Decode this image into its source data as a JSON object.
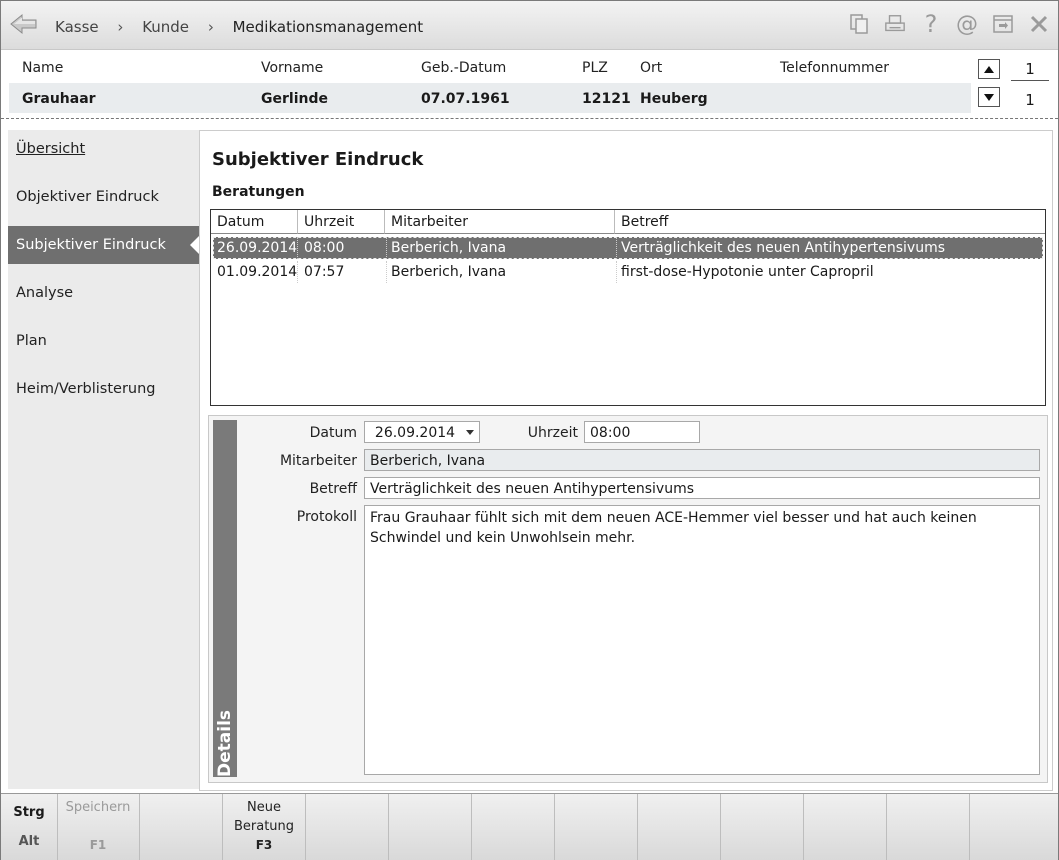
{
  "breadcrumb": [
    "Kasse",
    "Kunde",
    "Medikationsmanagement"
  ],
  "breadcrumb_sep": "›",
  "top_icons": [
    "document-icon",
    "print-icon",
    "help-icon",
    "at-icon",
    "window-icon",
    "close-icon"
  ],
  "customer": {
    "headers": {
      "name": "Name",
      "vorname": "Vorname",
      "geb": "Geb.-Datum",
      "plz": "PLZ",
      "ort": "Ort",
      "tel": "Telefonnummer"
    },
    "values": {
      "name": "Grauhaar",
      "vorname": "Gerlinde",
      "geb": "07.07.1961",
      "plz": "12121",
      "ort": "Heuberg",
      "tel": ""
    },
    "nav_top": "1",
    "nav_bottom": "1"
  },
  "nav": {
    "items": [
      {
        "label": "Übersicht",
        "active": false
      },
      {
        "label": "Objektiver Eindruck",
        "active": false
      },
      {
        "label": "Subjektiver Eindruck",
        "active": true
      },
      {
        "label": "Analyse",
        "active": false
      },
      {
        "label": "Plan",
        "active": false
      },
      {
        "label": "Heim/Verblisterung",
        "active": false
      }
    ]
  },
  "main": {
    "title": "Subjektiver Eindruck",
    "section": "Beratungen",
    "columns": [
      "Datum",
      "Uhrzeit",
      "Mitarbeiter",
      "Betreff"
    ],
    "rows": [
      {
        "datum": "26.09.2014",
        "uhrzeit": "08:00",
        "mitarbeiter": "Berberich, Ivana",
        "betreff": "Verträglichkeit des neuen Antihypertensivums"
      },
      {
        "datum": "01.09.2014",
        "uhrzeit": "07:57",
        "mitarbeiter": "Berberich, Ivana",
        "betreff": "first-dose-Hypotonie unter Capropril"
      }
    ]
  },
  "details": {
    "tab_label": "Details",
    "datum_label": "Datum",
    "datum_value": "26.09.2014",
    "uhrzeit_label": "Uhrzeit",
    "uhrzeit_value": "08:00",
    "mitarbeiter_label": "Mitarbeiter",
    "mitarbeiter_value": "Berberich, Ivana",
    "betreff_label": "Betreff",
    "betreff_value": "Verträglichkeit des neuen Antihypertensivums",
    "protokoll_label": "Protokoll",
    "protokoll_value": "Frau Grauhaar fühlt sich mit dem neuen ACE-Hemmer viel besser und hat auch keinen Schwindel und kein Unwohlsein mehr."
  },
  "fkeys": {
    "mod1": "Strg",
    "mod2": "Alt",
    "f1_label": "Speichern",
    "f1_key": "F1",
    "f3_label1": "Neue",
    "f3_label2": "Beratung",
    "f3_key": "F3"
  }
}
